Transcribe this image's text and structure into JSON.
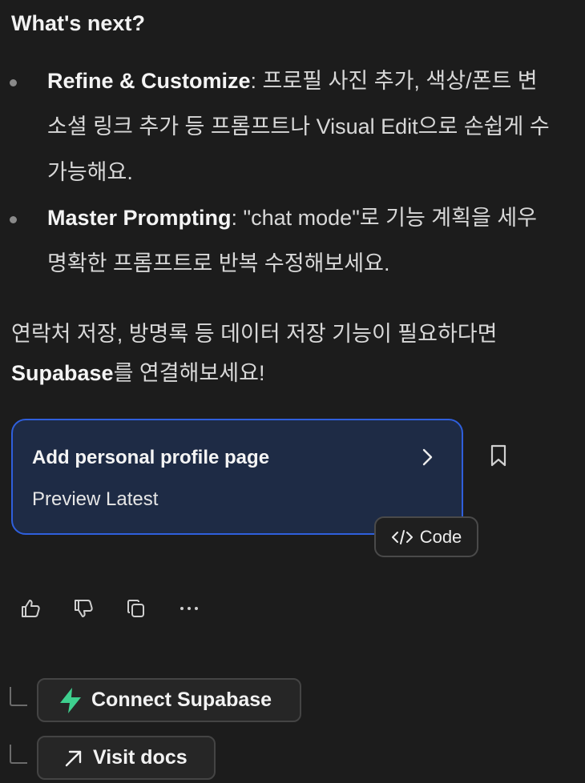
{
  "message": {
    "heading": "What's next?",
    "bullets": [
      {
        "bold": "Refine & Customize",
        "lines": [
          ": 프로필 사진 추가, 색상/폰트 변",
          "소셜 링크 추가 등 프롬프트나 Visual Edit으로 손쉽게 수",
          "가능해요."
        ]
      },
      {
        "bold": "Master Prompting",
        "lines": [
          ": \"chat mode\"로 기능 계획을 세우",
          "명확한 프롬프트로 반복 수정해보세요."
        ]
      }
    ],
    "paragraph_line1": "연락처 저장, 방명록 등 데이터 저장 기능이 필요하다면",
    "paragraph_bold": "Supabase",
    "paragraph_line2_rest": "를 연결해보세요!"
  },
  "version_card": {
    "title": "Add personal profile page",
    "subtitle": "Preview Latest",
    "code_label": "Code",
    "accent": "#2f5fdc",
    "background": "#1e2b45"
  },
  "actions": {
    "icons": [
      "thumbs-up-icon",
      "thumbs-down-icon",
      "copy-icon",
      "more-icon"
    ]
  },
  "suggestions": {
    "connect_supabase": "Connect Supabase",
    "visit_docs": "Visit docs",
    "supabase_color": "#3ecf8e"
  }
}
